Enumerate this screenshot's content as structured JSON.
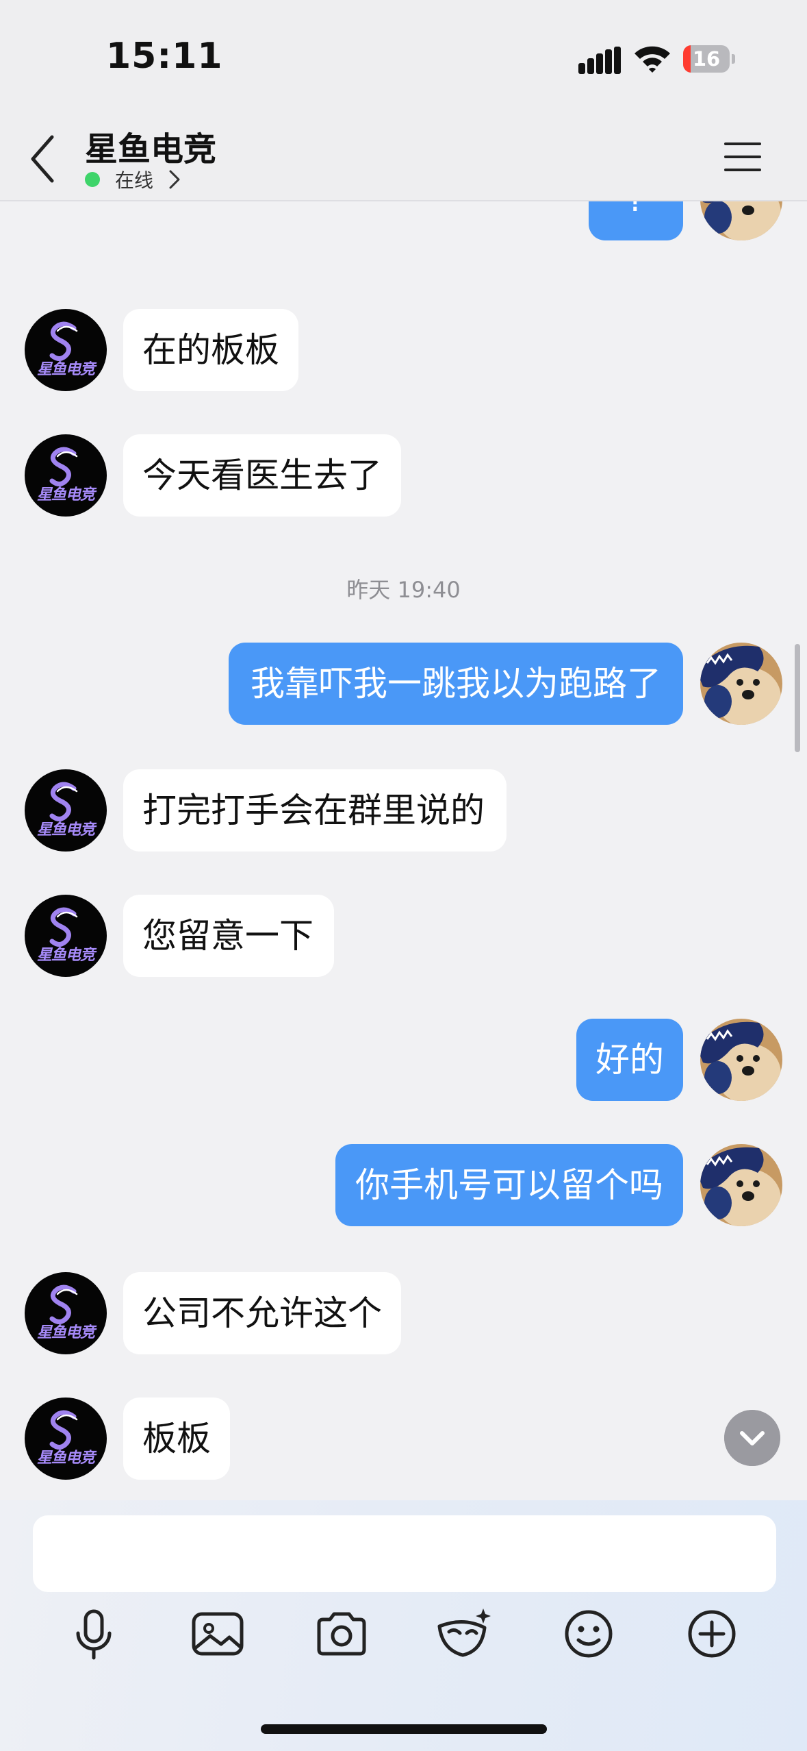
{
  "status_bar": {
    "time": "15:11",
    "battery": "16",
    "battery_level_percent": 16,
    "icons": [
      "cellular-signal-icon",
      "wifi-icon",
      "battery-icon"
    ]
  },
  "header": {
    "title": "星鱼电竞",
    "status": "在线",
    "icons": [
      "back-chevron-icon",
      "chevron-right-icon",
      "menu-icon"
    ],
    "online_color": "#3ed46a"
  },
  "brand_avatar_text": "星鱼电竞",
  "messages": [
    {
      "side": "out",
      "text": "?"
    },
    {
      "side": "in",
      "text": "在的板板"
    },
    {
      "side": "in",
      "text": "今天看医生去了"
    },
    {
      "side": "time",
      "text": "昨天 19:40"
    },
    {
      "side": "out",
      "text": "我靠吓我一跳我以为跑路了"
    },
    {
      "side": "in",
      "text": "打完打手会在群里说的"
    },
    {
      "side": "in",
      "text": "您留意一下"
    },
    {
      "side": "out",
      "text": "好的"
    },
    {
      "side": "out",
      "text": "你手机号可以留个吗"
    },
    {
      "side": "in",
      "text": "公司不允许这个"
    },
    {
      "side": "in",
      "text": "板板"
    }
  ],
  "input": {
    "placeholder": ""
  },
  "toolbar": {
    "icons": [
      "microphone-icon",
      "image-icon",
      "camera-icon",
      "mask-icon",
      "emoji-icon",
      "plus-icon"
    ]
  },
  "colors": {
    "outgoing_bubble": "#4a98f7",
    "incoming_bubble": "#ffffff",
    "background": "#f1f1f3"
  }
}
